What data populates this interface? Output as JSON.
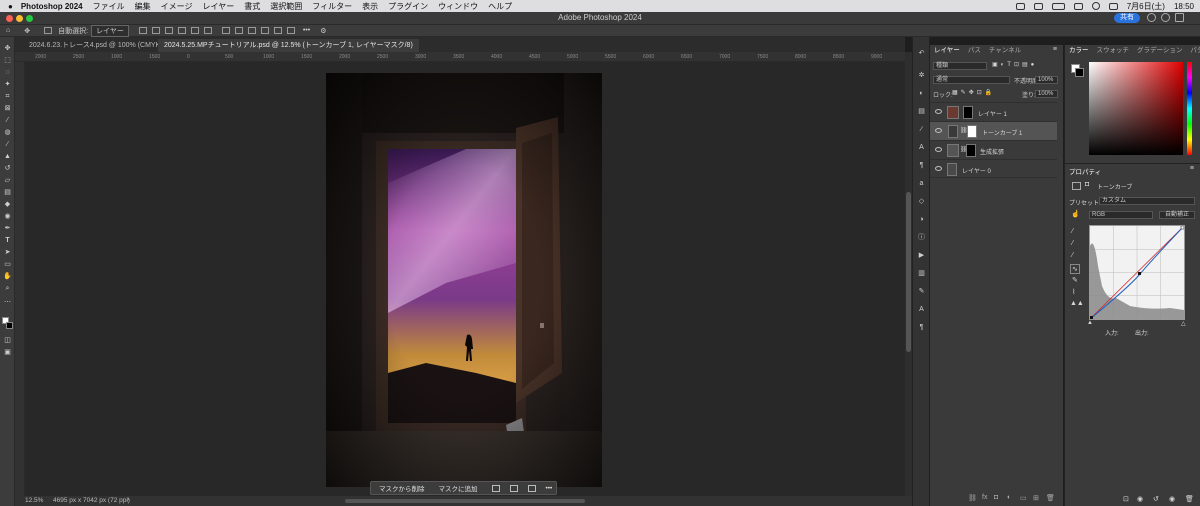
{
  "menubar": {
    "app_name": "Photoshop 2024",
    "items": [
      "ファイル",
      "編集",
      "イメージ",
      "レイヤー",
      "書式",
      "選択範囲",
      "フィルター",
      "表示",
      "プラグイン",
      "ウィンドウ",
      "ヘルプ"
    ],
    "date": "7月6日(土)",
    "time": "18:50"
  },
  "titlebar": {
    "title": "Adobe Photoshop 2024",
    "share_label": "共有"
  },
  "options": {
    "auto_select_label": "自動選択:",
    "auto_select_value": "レイヤー"
  },
  "tabs": [
    {
      "label": "2024.6.23.トレース4.psd @ 100% (CMYK/8)",
      "active": false
    },
    {
      "label": "2024.5.25.MPチュートリアル.psd @ 12.5% (トーンカーブ 1, レイヤーマスク/8)",
      "active": true
    }
  ],
  "ruler": {
    "ticks": [
      "2000",
      "2500",
      "1000",
      "1500",
      "0",
      "500",
      "1000",
      "1500",
      "2000",
      "2500",
      "3000",
      "3500",
      "4000",
      "4500",
      "5000",
      "5500",
      "6000",
      "6500",
      "7000",
      "7500",
      "8000",
      "8500",
      "9000"
    ]
  },
  "context_bar": {
    "remove_mask": "マスクから削除",
    "add_mask": "マスクに追加",
    "more": "•••"
  },
  "status": {
    "zoom": "12.5%",
    "doc_size": "4695 px x 7042 px (72 ppi)"
  },
  "layers_panel": {
    "tabs": [
      "レイヤー",
      "パス",
      "チャンネル"
    ],
    "kind_filter": "種類",
    "blend_mode": "通常",
    "opacity_label": "不透明度:",
    "opacity_value": "100%",
    "lock_label": "ロック:",
    "fill_label": "塗り:",
    "fill_value": "100%",
    "layers": [
      {
        "name": "レイヤー 1",
        "selected": false
      },
      {
        "name": "トーンカーブ 1",
        "selected": true
      },
      {
        "name": "生成拡張",
        "selected": false
      },
      {
        "name": "レイヤー 0",
        "selected": false
      }
    ]
  },
  "color_panel": {
    "tabs": [
      "カラー",
      "スウォッチ",
      "グラデーション",
      "パターン"
    ]
  },
  "properties_panel": {
    "title": "プロパティ",
    "adjustment_name": "トーンカーブ",
    "preset_label": "プリセット:",
    "preset_value": "カスタム",
    "channel_value": "RGB",
    "auto_label": "自動補正",
    "input_label": "入力:",
    "output_label": "出力:"
  }
}
